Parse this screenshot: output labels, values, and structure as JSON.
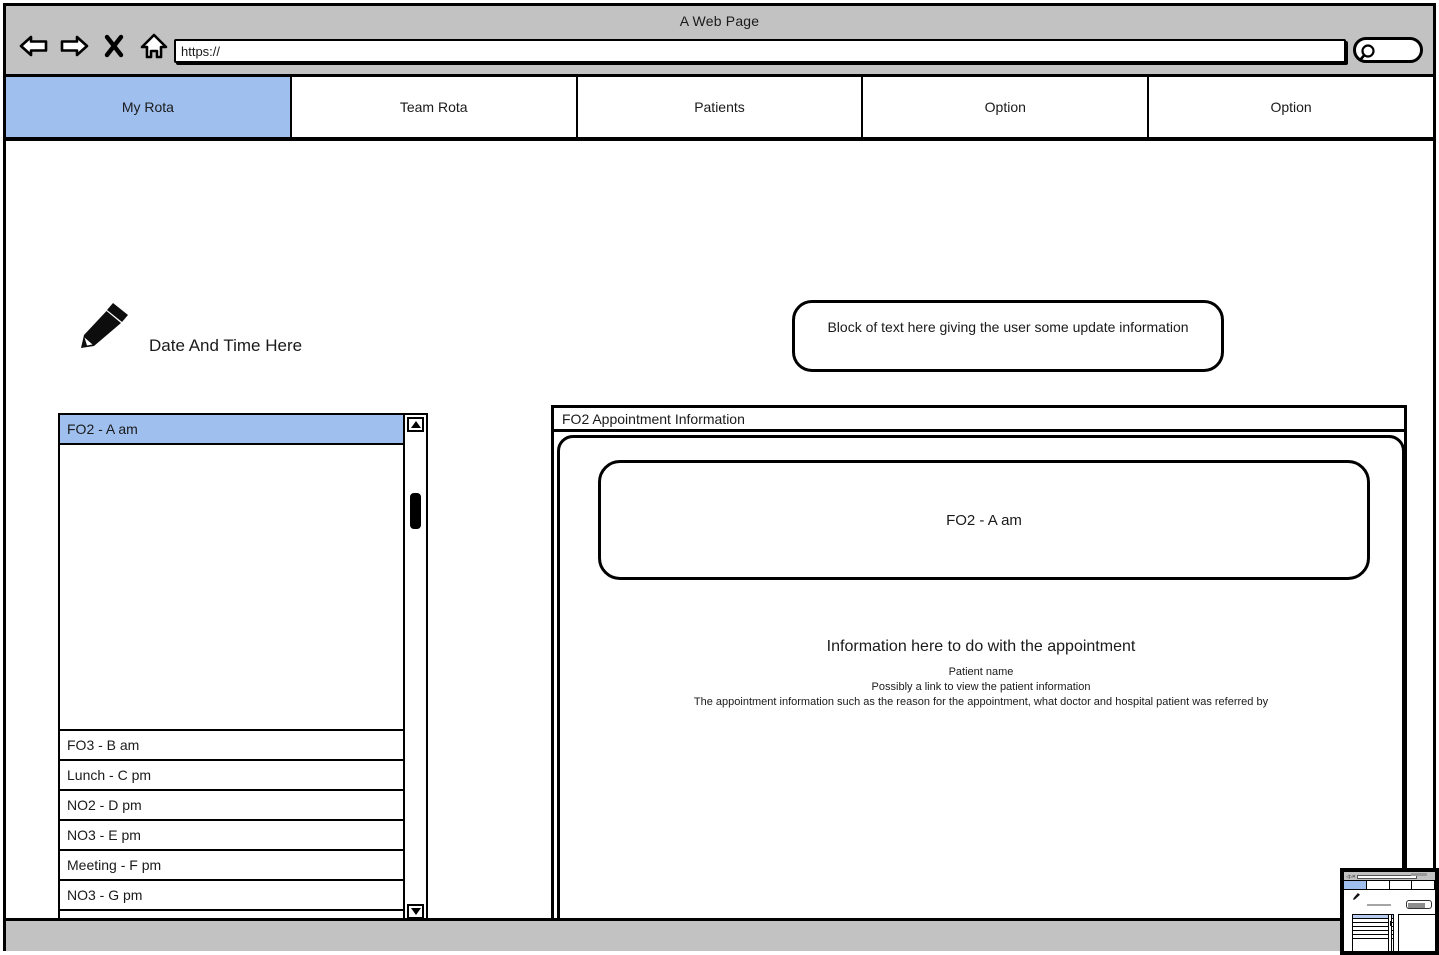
{
  "browser": {
    "window_title": "A Web Page",
    "url_value": "https://",
    "url_placeholder": "https://",
    "search_value": "",
    "nav": {
      "back": "back-arrow",
      "forward": "forward-arrow",
      "stop": "X",
      "home": "home-icon",
      "search": "search-icon"
    }
  },
  "tabs": [
    {
      "label": "My Rota",
      "active": true
    },
    {
      "label": "Team Rota",
      "active": false
    },
    {
      "label": "Patients",
      "active": false
    },
    {
      "label": "Option",
      "active": false
    },
    {
      "label": "Option",
      "active": false
    }
  ],
  "toolbar": {
    "edit_icon": "pencil-icon"
  },
  "header": {
    "date_time": "Date And Time Here",
    "update_message": "Block of text here giving the user some update information"
  },
  "rota_list": {
    "items": [
      {
        "label": "FO2 - A am",
        "selected": true
      },
      {
        "label": "FO3 - B am",
        "selected": false
      },
      {
        "label": "Lunch - C pm",
        "selected": false
      },
      {
        "label": "NO2 - D pm",
        "selected": false
      },
      {
        "label": "NO3 - E pm",
        "selected": false
      },
      {
        "label": "Meeting - F pm",
        "selected": false
      },
      {
        "label": "NO3 - G pm",
        "selected": false
      }
    ],
    "scrollbar": {
      "up_arrow": "triangle-up-icon",
      "down_arrow": "triangle-down-icon"
    }
  },
  "appointment": {
    "panel_title": "FO2 Appointment Information",
    "slot_label": "FO2 - A am",
    "info_title": "Information here to do with the appointment",
    "info_lines": [
      "Patient name",
      "Possibly a link to view the patient information",
      "The appointment information such as the reason for the appointment, what doctor and hospital patient was referred by"
    ]
  },
  "colors": {
    "accent_selected": "#9fc0ef",
    "chrome_gray": "#c2c2c2",
    "outline": "#000000"
  }
}
